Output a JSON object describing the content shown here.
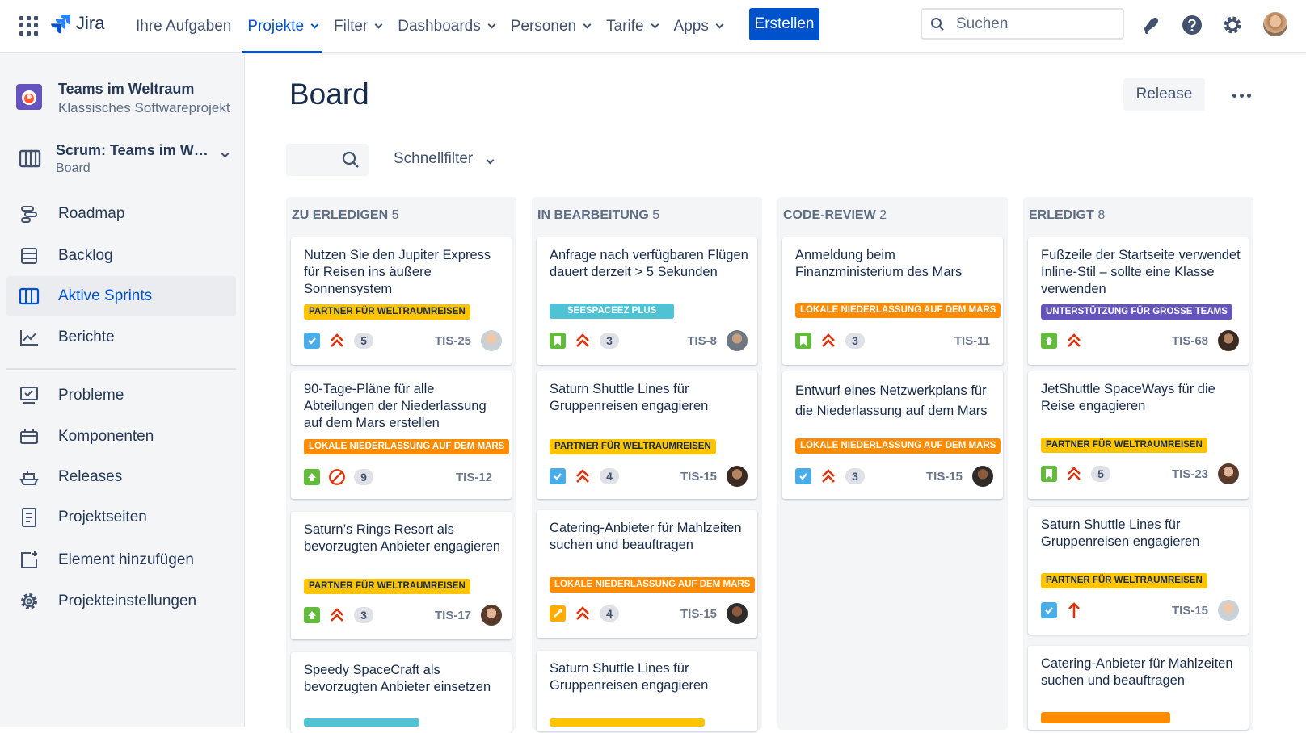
{
  "topnav": {
    "logo": "Jira",
    "items": [
      "Ihre Aufgaben",
      "Projekte",
      "Filter",
      "Dashboards",
      "Personen",
      "Tarife",
      "Apps"
    ],
    "create_label": "Erstellen",
    "search_placeholder": "Suchen"
  },
  "sidebar": {
    "project_title": "Teams im Weltraum",
    "project_subtitle": "Klassisches Softwareprojekt",
    "board_title": "Scrum: Teams im W…",
    "board_subtitle": "Board",
    "items": [
      {
        "label": "Roadmap",
        "icon": "roadmap-icon"
      },
      {
        "label": "Backlog",
        "icon": "backlog-icon"
      },
      {
        "label": "Aktive Sprints",
        "icon": "board-icon"
      },
      {
        "label": "Berichte",
        "icon": "chart-icon"
      },
      {
        "label": "Probleme",
        "icon": "issues-icon"
      },
      {
        "label": "Komponenten",
        "icon": "component-icon"
      },
      {
        "label": "Releases",
        "icon": "ship-icon"
      },
      {
        "label": "Projektseiten",
        "icon": "page-icon"
      },
      {
        "label": "Element hinzufügen",
        "icon": "add-item-icon"
      },
      {
        "label": "Projekteinstellungen",
        "icon": "gear-icon"
      }
    ]
  },
  "main": {
    "title": "Board",
    "release_label": "Release",
    "quickfilter_label": "Schnellfilter"
  },
  "columns": [
    {
      "title": "ZU ERLEDIGEN",
      "count": "5"
    },
    {
      "title": "IN BEARBEITUNG",
      "count": "5"
    },
    {
      "title": "CODE-REVIEW",
      "count": "2"
    },
    {
      "title": "ERLEDIGT",
      "count": "8"
    }
  ],
  "cards": {
    "c1": [
      {
        "title": "Nutzen Sie den Jupiter Express für Reisen ins äußere Sonnensystem",
        "tag": "PARTNER FÜR WELTRAUMREISEN",
        "points": "5",
        "key": "TIS-25"
      },
      {
        "title": "90-Tage-Pläne für alle Abteilungen der Niederlassung auf dem Mars erstellen",
        "tag": "LOKALE NIEDERLASSUNG AUF DEM MARS",
        "points": "9",
        "key": "TIS-12"
      },
      {
        "title": "Saturn’s Rings Resort als bevorzugten Anbieter engagieren",
        "tag": "PARTNER FÜR WELTRAUMREISEN",
        "points": "3",
        "key": "TIS-17"
      },
      {
        "title": "Speedy SpaceCraft als bevorzugten Anbieter einsetzen"
      }
    ],
    "c2": [
      {
        "title": "Anfrage nach verfügbaren Flügen dauert derzeit > 5 Sekunden",
        "tag": "SEESPACEEZ PLUS",
        "points": "3",
        "key": "TIS-8"
      },
      {
        "title": "Saturn Shuttle Lines für Gruppenreisen engagieren",
        "tag": "PARTNER FÜR WELTRAUMREISEN",
        "points": "4",
        "key": "TIS-15"
      },
      {
        "title": "Catering-Anbieter für Mahlzeiten suchen und beauftragen",
        "tag": "LOKALE NIEDERLASSUNG AUF DEM MARS",
        "points": "4",
        "key": "TIS-15"
      },
      {
        "title": "Saturn Shuttle Lines für Gruppenreisen engagieren"
      }
    ],
    "c3": [
      {
        "title": "Anmeldung beim Finanzministerium des Mars",
        "tag": "LOKALE NIEDERLASSUNG AUF DEM MARS",
        "points": "3",
        "key": "TIS-11"
      },
      {
        "title": "Entwurf eines Netzwerkplans für die Niederlassung auf dem Mars",
        "tag": "LOKALE NIEDERLASSUNG AUF DEM MARS",
        "points": "3",
        "key": "TIS-15"
      }
    ],
    "c4": [
      {
        "title": "Fußzeile der Startseite verwendet Inline-Stil – sollte eine Klasse verwenden",
        "tag": "UNTERSTÜTZUNG FÜR GROSSE TEAMS",
        "key": "TIS-68"
      },
      {
        "title": "JetShuttle SpaceWays für die Reise engagieren",
        "tag": "PARTNER FÜR WELTRAUMREISEN",
        "points": "5",
        "key": "TIS-23"
      },
      {
        "title": "Saturn Shuttle Lines für Gruppenreisen engagieren",
        "tag": "PARTNER FÜR WELTRAUMREISEN",
        "key": "TIS-15"
      },
      {
        "title": "Catering-Anbieter für Mahlzeiten suchen und beauftragen"
      }
    ]
  },
  "colors": {
    "brand": "#0052cc",
    "tag_yellow": "#ffc400",
    "tag_orange": "#ff8b00",
    "tag_teal": "#4fc3d4",
    "tag_purple": "#6554c0"
  }
}
